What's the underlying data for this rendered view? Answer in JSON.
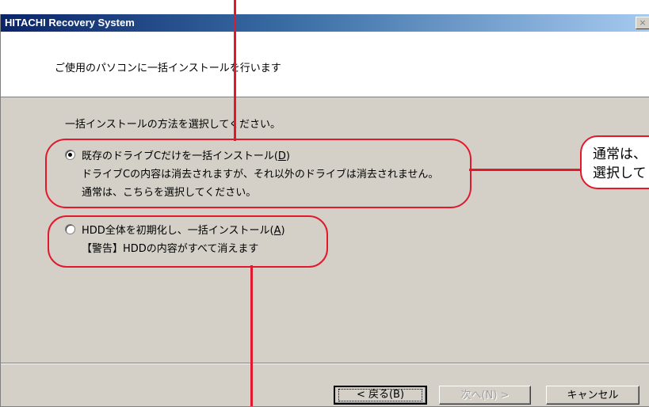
{
  "window": {
    "title": "HITACHI Recovery System",
    "close_glyph": "×"
  },
  "header": {
    "text": "ご使用のパソコンに一括インストールを行います"
  },
  "instruction": "一括インストールの方法を選択してください。",
  "options": [
    {
      "label_before": "既存のドライブCだけを一括インストール(",
      "key": "D",
      "label_after": ")",
      "desc1": "ドライブCの内容は消去されますが、それ以外のドライブは消去されません。",
      "desc2": "通常は、こちらを選択してください。",
      "checked": true
    },
    {
      "label_before": "HDD全体を初期化し、一括インストール(",
      "key": "A",
      "label_after": ")",
      "desc1": "【警告】HDDの内容がすべて消えます",
      "checked": false
    }
  ],
  "buttons": {
    "back": "< 戻る(B)",
    "next": "次へ(N) >",
    "cancel": "キャンセル"
  },
  "annotation": {
    "line1": "通常は、",
    "line2": "選択して"
  },
  "colors": {
    "annotation_red": "#e2192c",
    "titlebar": "#0a246a",
    "dialog_bg": "#d4d0c8"
  }
}
